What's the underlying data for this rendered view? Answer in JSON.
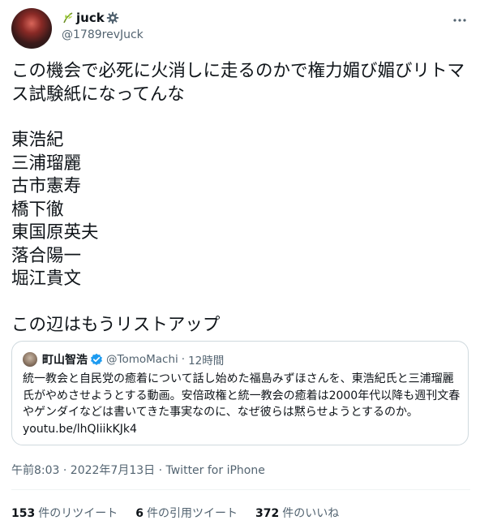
{
  "author": {
    "display_name": "juck",
    "handle": "@1789revJuck"
  },
  "tweet": {
    "main_text": "この機会で必死に火消しに走るのかで権力媚び媚びリトマス試験紙になってんな",
    "names_list": [
      "東浩紀",
      "三浦瑠麗",
      "古市憲寿",
      "橋下徹",
      "東国原英夫",
      "落合陽一",
      "堀江貴文"
    ],
    "closing_text": "この辺はもうリストアップ"
  },
  "quote": {
    "display_name": "町山智浩",
    "handle": "@TomoMachi",
    "separator": "·",
    "time": "12時間",
    "text": "統一教会と自民党の癒着について話し始めた福島みずほさんを、東浩紀氏と三浦瑠麗氏がやめさせようとする動画。安倍政権と統一教会の癒着は2000年代以降も週刊文春やゲンダイなどは書いてきた事実なのに、なぜ彼らは黙らせようとするのか。",
    "link": "youtu.be/lhQIiikKJk4"
  },
  "meta": {
    "timestamp": "午前8:03 · 2022年7月13日",
    "separator": "·",
    "source": "Twitter for iPhone"
  },
  "stats": {
    "retweets": {
      "count": "153",
      "label": "件のリツイート"
    },
    "quotes": {
      "count": "6",
      "label": "件の引用ツイート"
    },
    "likes": {
      "count": "372",
      "label": "件のいいね"
    }
  },
  "colors": {
    "text_primary": "#0f1419",
    "text_secondary": "#536471",
    "border": "#cfd9de",
    "verified": "#1d9bf0"
  },
  "icons": [
    "leaf-icon",
    "gear-icon",
    "more-icon",
    "verified-icon"
  ]
}
